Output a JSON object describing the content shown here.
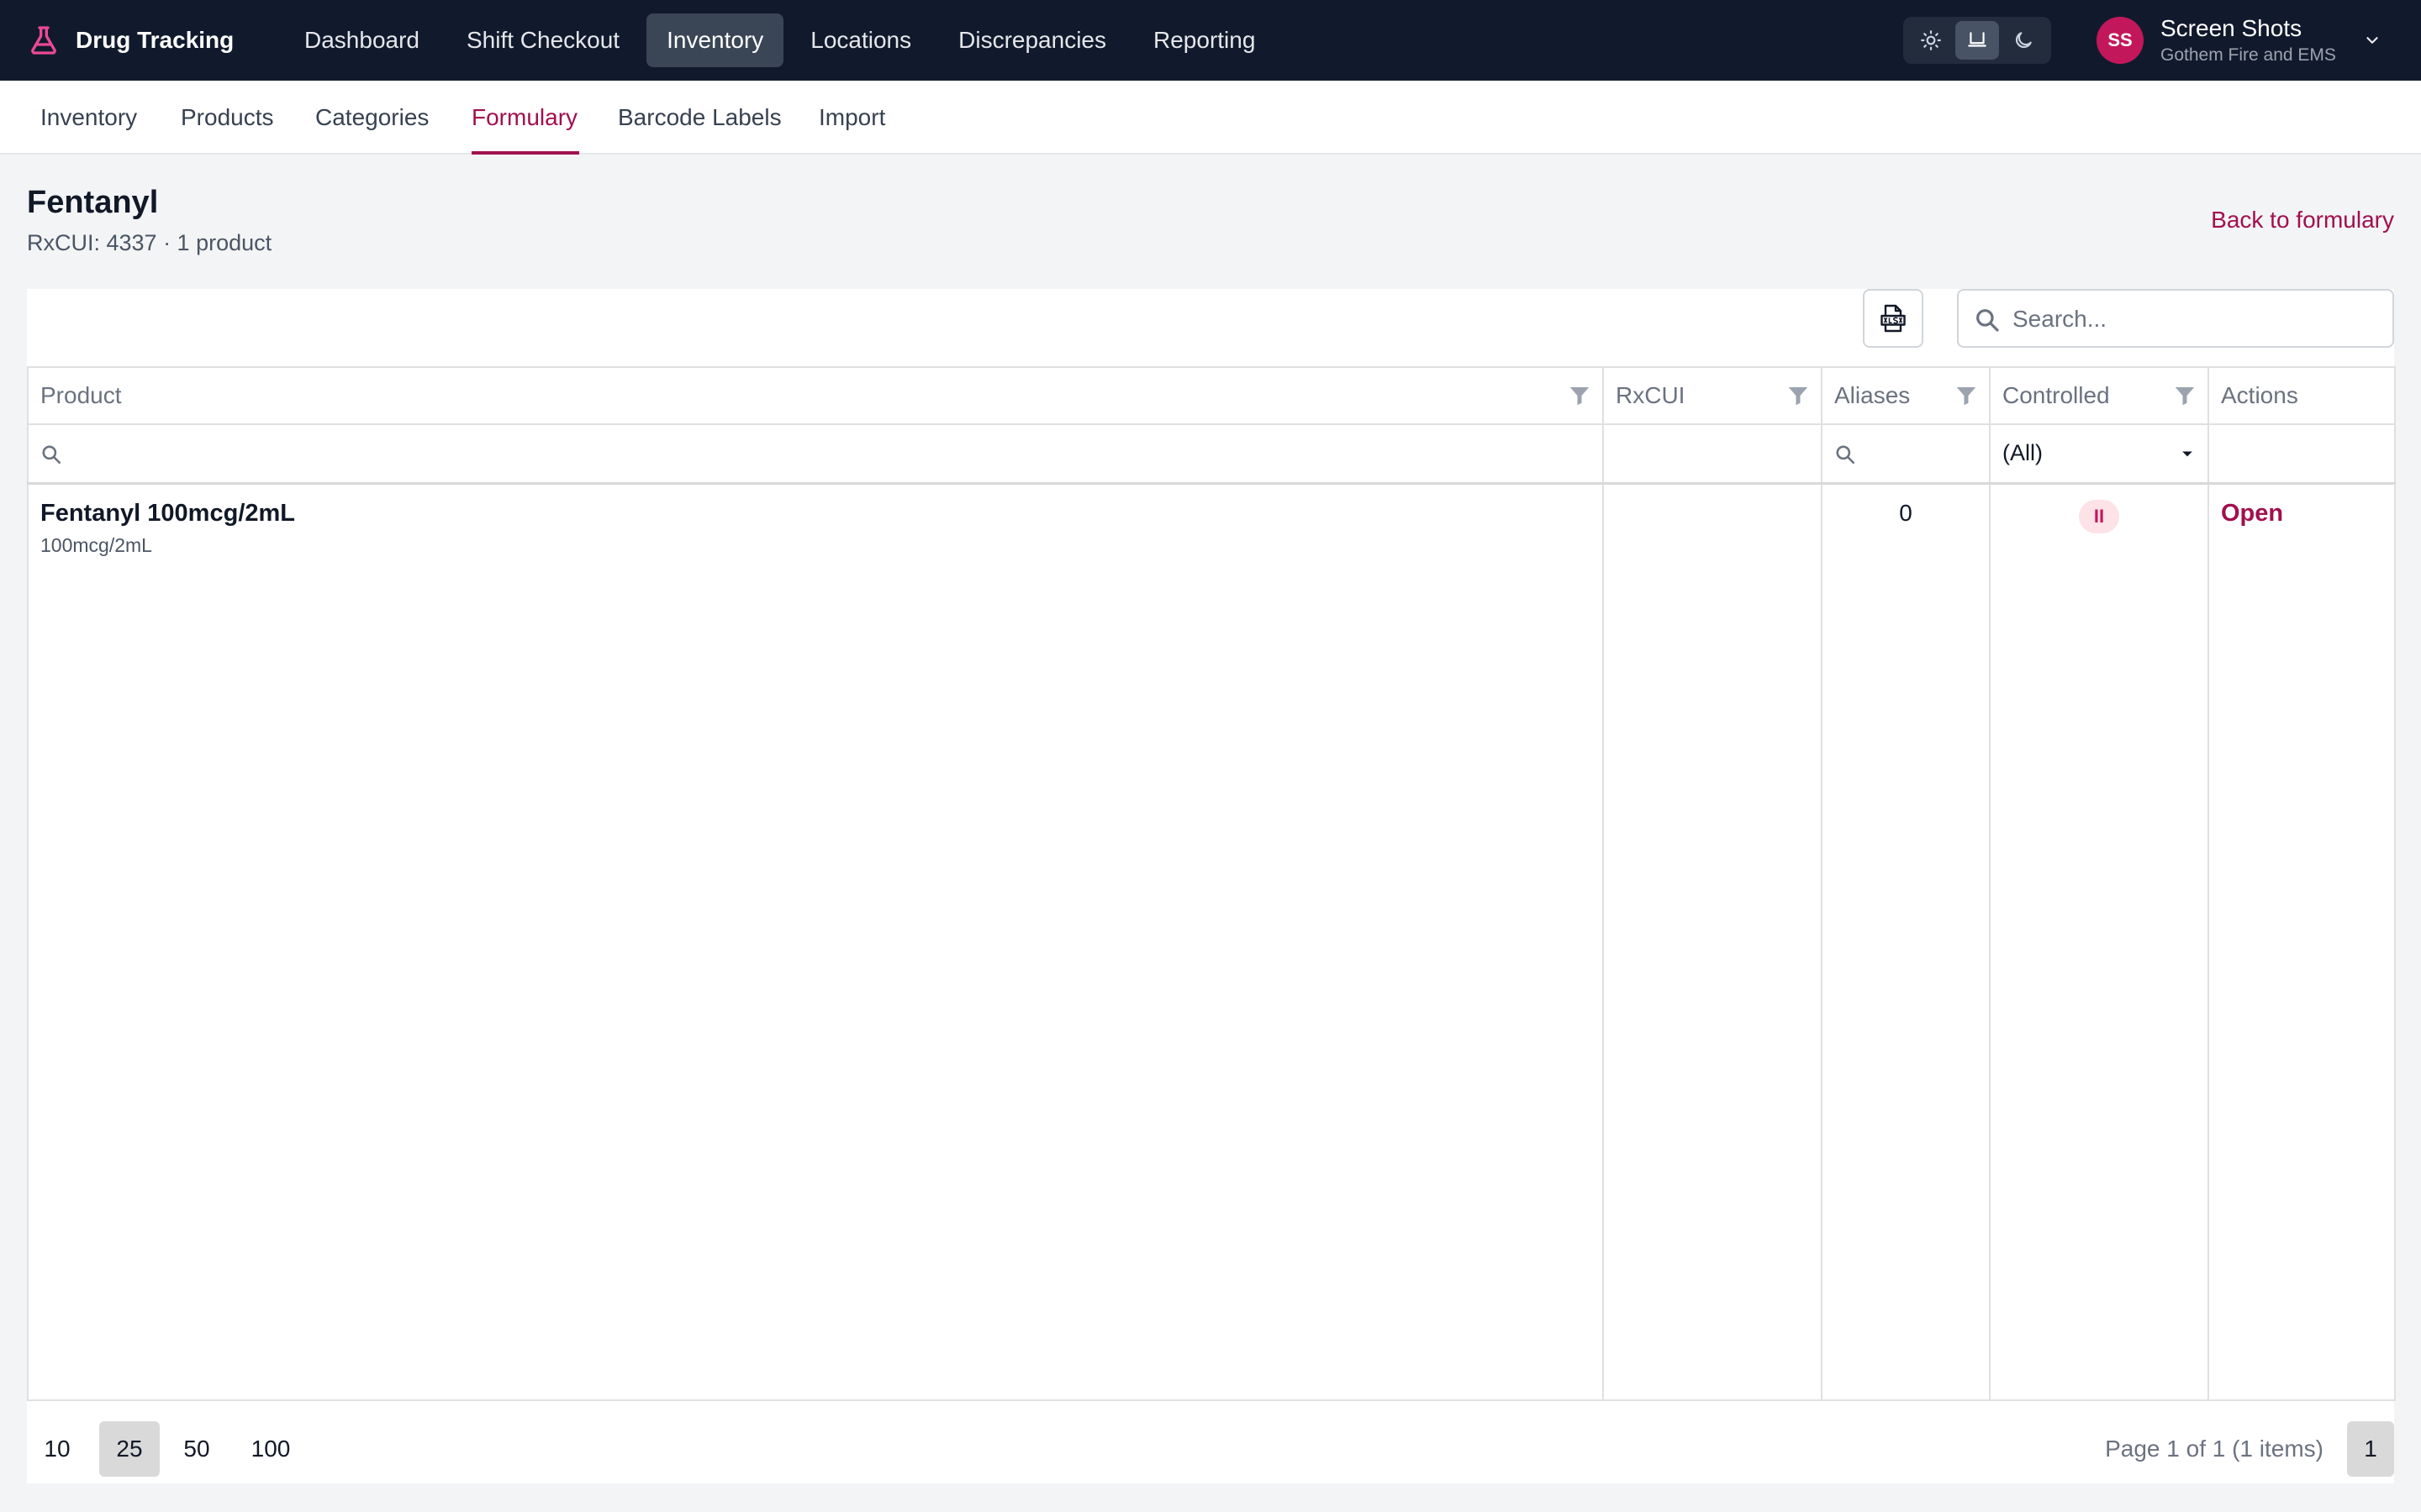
{
  "app": {
    "brand_name": "Drug Tracking",
    "colors": {
      "nav_bg": "#111a2c",
      "accent": "#a1104e",
      "avatar": "#c2185b"
    }
  },
  "main_nav": {
    "items": [
      {
        "label": "Dashboard"
      },
      {
        "label": "Shift Checkout"
      },
      {
        "label": "Inventory",
        "active": true
      },
      {
        "label": "Locations"
      },
      {
        "label": "Discrepancies"
      },
      {
        "label": "Reporting"
      }
    ]
  },
  "theme_toggle": {
    "options": [
      "light-icon",
      "system-icon",
      "dark-icon"
    ],
    "selected": "system"
  },
  "user": {
    "initials": "SS",
    "name": "Screen Shots",
    "org": "Gothem Fire and EMS"
  },
  "sub_nav": {
    "items": [
      {
        "label": "Inventory"
      },
      {
        "label": "Products"
      },
      {
        "label": "Categories"
      },
      {
        "label": "Formulary",
        "active": true
      },
      {
        "label": "Barcode Labels"
      },
      {
        "label": "Import"
      }
    ]
  },
  "page": {
    "title": "Fentanyl",
    "subtitle": "RxCUI: 4337 · 1 product",
    "back_link": "Back to formulary"
  },
  "grid": {
    "search_placeholder": "Search...",
    "columns": {
      "product": "Product",
      "rxcui": "RxCUI",
      "aliases": "Aliases",
      "controlled": "Controlled",
      "actions": "Actions"
    },
    "filters": {
      "controlled_value": "(All)"
    },
    "rows": [
      {
        "product_name": "Fentanyl 100mcg/2mL",
        "product_strength": "100mcg/2mL",
        "rxcui": "",
        "aliases": "0",
        "controlled_badge": "II",
        "action": "Open"
      }
    ],
    "pager": {
      "sizes": [
        "10",
        "25",
        "50",
        "100"
      ],
      "selected_size": "25",
      "info": "Page 1 of 1 (1 items)",
      "current_page": "1"
    }
  }
}
